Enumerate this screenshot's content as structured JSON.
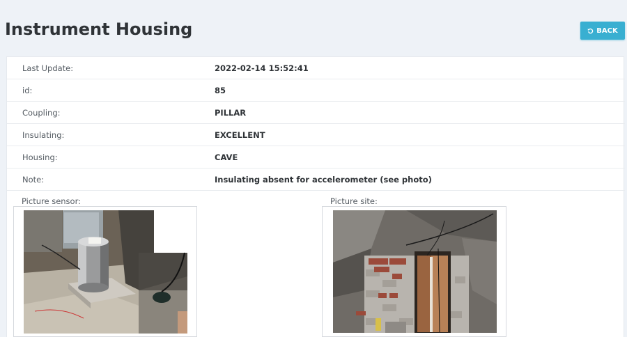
{
  "header": {
    "title": "Instrument Housing",
    "back_label": "BACK"
  },
  "details": {
    "rows": [
      {
        "label": "Last Update:",
        "value": "2022-02-14 15:52:41"
      },
      {
        "label": "id:",
        "value": "85"
      },
      {
        "label": "Coupling:",
        "value": "PILLAR"
      },
      {
        "label": "Insulating:",
        "value": "EXCELLENT"
      },
      {
        "label": "Housing:",
        "value": "CAVE"
      },
      {
        "label": "Note:",
        "value": "Insulating absent for accelerometer (see photo)"
      }
    ]
  },
  "pictures": {
    "sensor_label": "Picture sensor:",
    "site_label": "Picture site:"
  },
  "colors": {
    "accent": "#39afd1",
    "background": "#eef2f7"
  }
}
